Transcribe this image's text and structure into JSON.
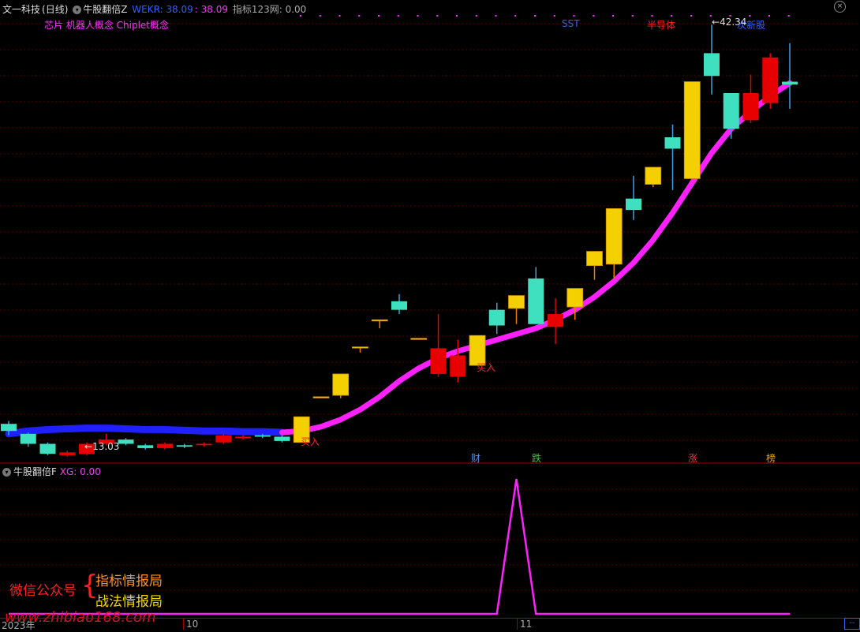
{
  "main_panel": {
    "stock_name": "文一科技",
    "period": "(日线)",
    "indicator_name": "牛股翻倍Z",
    "wekr_label": "WEKR: 38.09",
    "wekr_value": ": 38.09",
    "metric_label": "指标123网: 0.00",
    "concepts": "芯片 机器人概念 Chiplet概念",
    "tag_sst": "SST",
    "tag_semi": "半导体",
    "tag_new": "次新股",
    "low_label": "13.03",
    "high_label": "42.34",
    "buy_label_1": "买入",
    "buy_label_2": "买入",
    "events": [
      "财",
      "跌",
      "涨",
      "榜"
    ]
  },
  "sub_panel": {
    "indicator_name": "牛股翻倍F",
    "xg_label": "XG: 0.00"
  },
  "footer": {
    "year_label": "2023年",
    "month_10": "10",
    "month_11": "11",
    "corner": "--"
  },
  "watermark": {
    "wechat": "微信公众号",
    "line1": "指标情报局",
    "line2": "战法情报局",
    "url": "www.zhibiao168.com"
  },
  "colors": {
    "up_gold": "#f5d000",
    "up_teal": "#3fe0c0",
    "down_red": "#e60000",
    "line_pink": "#ff20ff",
    "line_blue": "#2020ff"
  },
  "chart_data": {
    "type": "candlestick",
    "y_low_label": 13.03,
    "y_high_label": 42.34,
    "candles": [
      {
        "o": 13.8,
        "c": 14.3,
        "h": 14.5,
        "l": 13.5,
        "color": "teal"
      },
      {
        "o": 13.6,
        "c": 12.9,
        "h": 13.7,
        "l": 12.7,
        "color": "teal"
      },
      {
        "o": 12.9,
        "c": 12.2,
        "h": 13.0,
        "l": 12.1,
        "color": "teal"
      },
      {
        "o": 12.3,
        "c": 12.1,
        "h": 12.4,
        "l": 12.0,
        "color": "red"
      },
      {
        "o": 12.2,
        "c": 12.9,
        "h": 13.0,
        "l": 12.1,
        "color": "red"
      },
      {
        "o": 12.9,
        "c": 13.2,
        "h": 13.6,
        "l": 12.8,
        "color": "red"
      },
      {
        "o": 13.2,
        "c": 12.9,
        "h": 13.3,
        "l": 12.8,
        "color": "teal"
      },
      {
        "o": 12.8,
        "c": 12.6,
        "h": 12.9,
        "l": 12.5,
        "color": "teal"
      },
      {
        "o": 12.6,
        "c": 12.9,
        "h": 13.0,
        "l": 12.5,
        "color": "red"
      },
      {
        "o": 12.8,
        "c": 12.7,
        "h": 12.9,
        "l": 12.6,
        "color": "teal"
      },
      {
        "o": 12.8,
        "c": 12.9,
        "h": 13.0,
        "l": 12.7,
        "color": "red"
      },
      {
        "o": 13.0,
        "c": 13.5,
        "h": 13.6,
        "l": 12.9,
        "color": "red"
      },
      {
        "o": 13.3,
        "c": 13.4,
        "h": 13.5,
        "l": 13.2,
        "color": "red"
      },
      {
        "o": 13.4,
        "c": 13.5,
        "h": 13.6,
        "l": 13.3,
        "color": "teal"
      },
      {
        "o": 13.4,
        "c": 13.1,
        "h": 13.5,
        "l": 13.0,
        "color": "teal"
      },
      {
        "o": 13.0,
        "c": 14.8,
        "h": 14.8,
        "l": 13.0,
        "color": "gold"
      },
      {
        "o": 16.2,
        "c": 16.2,
        "h": 16.2,
        "l": 16.2,
        "color": "gold"
      },
      {
        "o": 16.3,
        "c": 17.8,
        "h": 17.8,
        "l": 16.1,
        "color": "gold"
      },
      {
        "o": 19.7,
        "c": 19.7,
        "h": 19.7,
        "l": 19.3,
        "color": "gold"
      },
      {
        "o": 21.6,
        "c": 21.6,
        "h": 21.6,
        "l": 21.0,
        "color": "gold"
      },
      {
        "o": 22.9,
        "c": 22.3,
        "h": 23.4,
        "l": 22.0,
        "color": "teal"
      },
      {
        "o": 20.3,
        "c": 20.3,
        "h": 20.3,
        "l": 20.3,
        "color": "gold"
      },
      {
        "o": 19.6,
        "c": 17.8,
        "h": 22.0,
        "l": 17.6,
        "color": "red"
      },
      {
        "o": 19.1,
        "c": 17.6,
        "h": 20.2,
        "l": 17.2,
        "color": "red"
      },
      {
        "o": 18.4,
        "c": 20.5,
        "h": 20.5,
        "l": 18.4,
        "color": "gold"
      },
      {
        "o": 21.2,
        "c": 22.3,
        "h": 22.8,
        "l": 20.6,
        "color": "teal"
      },
      {
        "o": 22.4,
        "c": 23.3,
        "h": 23.3,
        "l": 21.3,
        "color": "gold"
      },
      {
        "o": 21.3,
        "c": 24.5,
        "h": 25.3,
        "l": 21.3,
        "color": "teal"
      },
      {
        "o": 22.0,
        "c": 21.1,
        "h": 23.1,
        "l": 19.9,
        "color": "red"
      },
      {
        "o": 22.5,
        "c": 23.8,
        "h": 23.8,
        "l": 21.6,
        "color": "gold"
      },
      {
        "o": 25.4,
        "c": 26.4,
        "h": 26.4,
        "l": 24.4,
        "color": "gold"
      },
      {
        "o": 25.5,
        "c": 29.4,
        "h": 29.4,
        "l": 24.5,
        "color": "gold"
      },
      {
        "o": 29.3,
        "c": 30.1,
        "h": 31.7,
        "l": 28.6,
        "color": "teal"
      },
      {
        "o": 31.1,
        "c": 32.3,
        "h": 32.3,
        "l": 30.9,
        "color": "gold"
      },
      {
        "o": 33.6,
        "c": 34.4,
        "h": 35.3,
        "l": 30.7,
        "color": "teal"
      },
      {
        "o": 31.5,
        "c": 38.3,
        "h": 38.3,
        "l": 31.5,
        "color": "gold"
      },
      {
        "o": 38.7,
        "c": 40.3,
        "h": 42.3,
        "l": 37.4,
        "color": "teal"
      },
      {
        "o": 35.0,
        "c": 37.5,
        "h": 37.5,
        "l": 34.3,
        "color": "teal"
      },
      {
        "o": 37.5,
        "c": 35.6,
        "h": 38.8,
        "l": 35.4,
        "color": "red"
      },
      {
        "o": 40.0,
        "c": 36.8,
        "h": 40.3,
        "l": 36.4,
        "color": "red"
      },
      {
        "o": 38.3,
        "c": 38.1,
        "h": 41.0,
        "l": 36.4,
        "color": "teal"
      }
    ],
    "trend_line": [
      13.6,
      13.8,
      13.9,
      13.95,
      14.0,
      14.0,
      13.95,
      13.9,
      13.9,
      13.85,
      13.8,
      13.8,
      13.75,
      13.75,
      13.7,
      13.8,
      14.1,
      14.6,
      15.3,
      16.2,
      17.3,
      18.2,
      18.9,
      19.4,
      19.8,
      20.2,
      20.6,
      21.0,
      21.6,
      22.3,
      23.2,
      24.3,
      25.6,
      27.2,
      29.1,
      31.2,
      33.3,
      35.0,
      36.2,
      37.3,
      38.2
    ],
    "trend_blue_until_index": 14,
    "xg": [
      0,
      0,
      0,
      0,
      0,
      0,
      0,
      0,
      0,
      0,
      0,
      0,
      0,
      0,
      0,
      0,
      0,
      0,
      0,
      0,
      0,
      0,
      0,
      0,
      0,
      0,
      1,
      0,
      0,
      0,
      0,
      0,
      0,
      0,
      0,
      0,
      0,
      0,
      0,
      0,
      0
    ],
    "buy_signal_indices": [
      15,
      24
    ],
    "event_indices": [
      24,
      27,
      35,
      39
    ]
  }
}
